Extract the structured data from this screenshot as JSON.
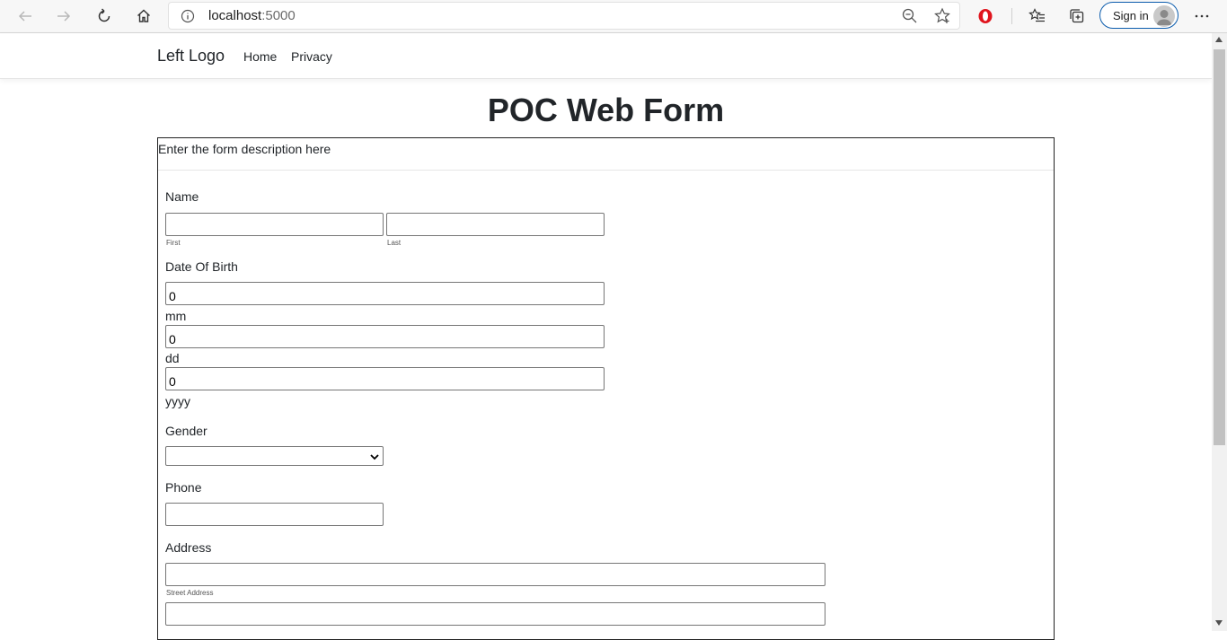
{
  "browser": {
    "url_host": "localhost",
    "url_port": ":5000",
    "signin_label": "Sign in"
  },
  "nav": {
    "brand": "Left Logo",
    "links": [
      "Home",
      "Privacy"
    ]
  },
  "form": {
    "title": "POC Web Form",
    "description": "Enter the form description here",
    "name_label": "Name",
    "first_label": "First",
    "last_label": "Last",
    "first_value": "",
    "last_value": "",
    "dob_label": "Date Of Birth",
    "dob_mm_value": "0",
    "dob_dd_value": "0",
    "dob_yyyy_value": "0",
    "mm_label": "mm",
    "dd_label": "dd",
    "yyyy_label": "yyyy",
    "gender_label": "Gender",
    "gender_value": "",
    "phone_label": "Phone",
    "phone_value": "",
    "address_label": "Address",
    "street_label": "Street Address",
    "street_value": "",
    "line2_value": ""
  }
}
